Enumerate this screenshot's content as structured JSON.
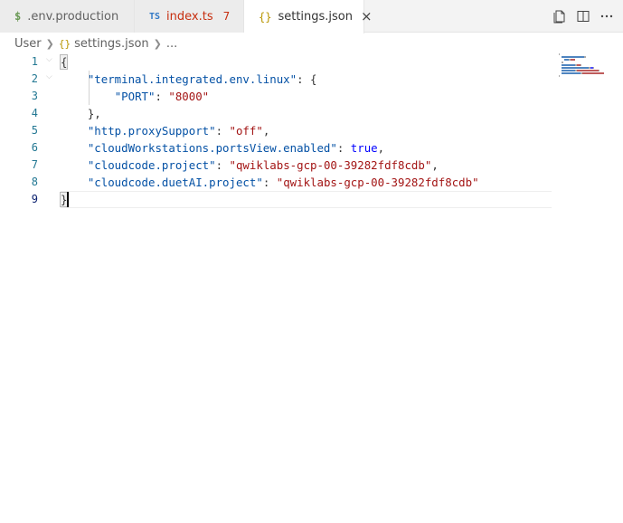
{
  "tabs": [
    {
      "icon": "$",
      "label": ".env.production"
    },
    {
      "icon": "TS",
      "label": "index.ts",
      "badge": "7"
    },
    {
      "icon": "{}",
      "label": "settings.json",
      "close": "×"
    }
  ],
  "breadcrumb": {
    "root": "User",
    "file": "settings.json",
    "more": "..."
  },
  "editor": {
    "line_numbers": [
      "1",
      "2",
      "3",
      "4",
      "5",
      "6",
      "7",
      "8",
      "9"
    ],
    "lines": [
      {
        "tokens": [
          {
            "t": "{",
            "c": "p"
          }
        ]
      },
      {
        "tokens": [
          {
            "t": "    "
          },
          {
            "t": "\"terminal.integrated.env.linux\"",
            "c": "k"
          },
          {
            "t": ": {",
            "c": "p"
          }
        ]
      },
      {
        "tokens": [
          {
            "t": "        "
          },
          {
            "t": "\"PORT\"",
            "c": "k"
          },
          {
            "t": ": ",
            "c": "p"
          },
          {
            "t": "\"8000\"",
            "c": "s"
          }
        ]
      },
      {
        "tokens": [
          {
            "t": "    "
          },
          {
            "t": "},",
            "c": "p"
          }
        ]
      },
      {
        "tokens": [
          {
            "t": "    "
          },
          {
            "t": "\"http.proxySupport\"",
            "c": "k"
          },
          {
            "t": ": ",
            "c": "p"
          },
          {
            "t": "\"off\"",
            "c": "s"
          },
          {
            "t": ",",
            "c": "p"
          }
        ]
      },
      {
        "tokens": [
          {
            "t": "    "
          },
          {
            "t": "\"cloudWorkstations.portsView.enabled\"",
            "c": "k"
          },
          {
            "t": ": ",
            "c": "p"
          },
          {
            "t": "true",
            "c": "b"
          },
          {
            "t": ",",
            "c": "p"
          }
        ]
      },
      {
        "tokens": [
          {
            "t": "    "
          },
          {
            "t": "\"cloudcode.project\"",
            "c": "k"
          },
          {
            "t": ": ",
            "c": "p"
          },
          {
            "t": "\"qwiklabs-gcp-00-39282fdf8cdb\"",
            "c": "s"
          },
          {
            "t": ",",
            "c": "p"
          }
        ]
      },
      {
        "tokens": [
          {
            "t": "    "
          },
          {
            "t": "\"cloudcode.duetAI.project\"",
            "c": "k"
          },
          {
            "t": ": ",
            "c": "p"
          },
          {
            "t": "\"qwiklabs-gcp-00-39282fdf8cdb\"",
            "c": "s"
          }
        ]
      },
      {
        "tokens": [
          {
            "t": "}",
            "c": "p"
          }
        ]
      }
    ]
  },
  "colors": {
    "key": "#0451a5",
    "string": "#a31515",
    "boolean": "#0000ff",
    "error": "#c72e0f",
    "line_number": "#237893"
  },
  "icons": {
    "actions": [
      "open-changes-icon",
      "split-editor-icon",
      "more-actions-icon"
    ]
  }
}
